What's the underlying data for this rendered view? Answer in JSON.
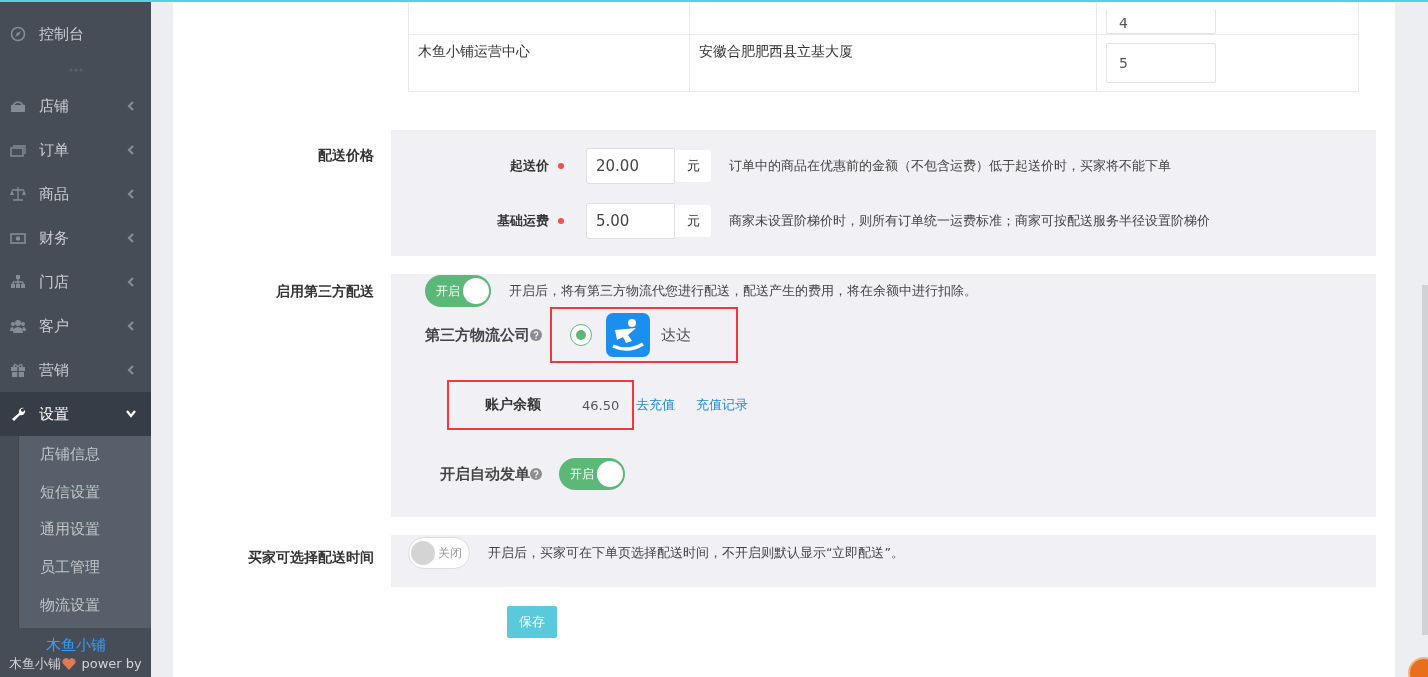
{
  "sidebar": {
    "items": [
      {
        "label": "控制台"
      },
      {
        "label": "店铺",
        "expanded": false,
        "selected": false
      },
      {
        "label": "订单",
        "expanded": false,
        "selected": false
      },
      {
        "label": "商品",
        "expanded": false,
        "selected": false
      },
      {
        "label": "财务",
        "expanded": false,
        "selected": false
      },
      {
        "label": "门店",
        "expanded": false,
        "selected": false
      },
      {
        "label": "客户",
        "expanded": false,
        "selected": false
      },
      {
        "label": "营销",
        "expanded": false,
        "selected": false
      },
      {
        "label": "设置",
        "expanded": true,
        "selected": true,
        "children": [
          {
            "label": "店铺信息"
          },
          {
            "label": "短信设置"
          },
          {
            "label": "通用设置"
          },
          {
            "label": "员工管理"
          },
          {
            "label": "物流设置"
          }
        ]
      }
    ],
    "footer": {
      "brand": "木鱼小铺",
      "credit_start": "木鱼小铺",
      "credit_end": "power by"
    }
  },
  "table": {
    "rows": [
      {
        "value": "4"
      },
      {
        "name": "木鱼小铺运营中心",
        "address": "安徽合肥肥西县立基大厦",
        "value": "5"
      }
    ]
  },
  "delivery_price": {
    "label": "配送价格",
    "fields": [
      {
        "label": "起送价",
        "required": true,
        "value": "20.00",
        "unit": "元",
        "hint": "订单中的商品在优惠前的金额（不包含运费）低于起送价时，买家将不能下单"
      },
      {
        "label": "基础运费",
        "required": true,
        "value": "5.00",
        "unit": "元",
        "hint": "商家未设置阶梯价时，则所有订单统一运费标准；商家可按配送服务半径设置阶梯价"
      }
    ]
  },
  "third_party": {
    "label": "启用第三方配送",
    "toggle": {
      "on": true,
      "text": "开启"
    },
    "hint": "开启后，将有第三方物流代您进行配送，配送产生的费用，将在余额中进行扣除。",
    "company": {
      "label": "第三方物流公司",
      "options": [
        {
          "name": "达达",
          "selected": true
        }
      ]
    },
    "balance": {
      "label": "账户余额",
      "value": "46.50",
      "links": [
        "去充值",
        "充值记录"
      ]
    },
    "auto_dispatch": {
      "label": "开启自动发单",
      "toggle": {
        "on": true,
        "text": "开启"
      }
    }
  },
  "buyer_time": {
    "label": "买家可选择配送时间",
    "toggle": {
      "on": false,
      "text": "关闭"
    },
    "hint": "开启后，买家可在下单页选择配送时间，不开启则默认显示“立即配送”。"
  },
  "save_button": "保存"
}
